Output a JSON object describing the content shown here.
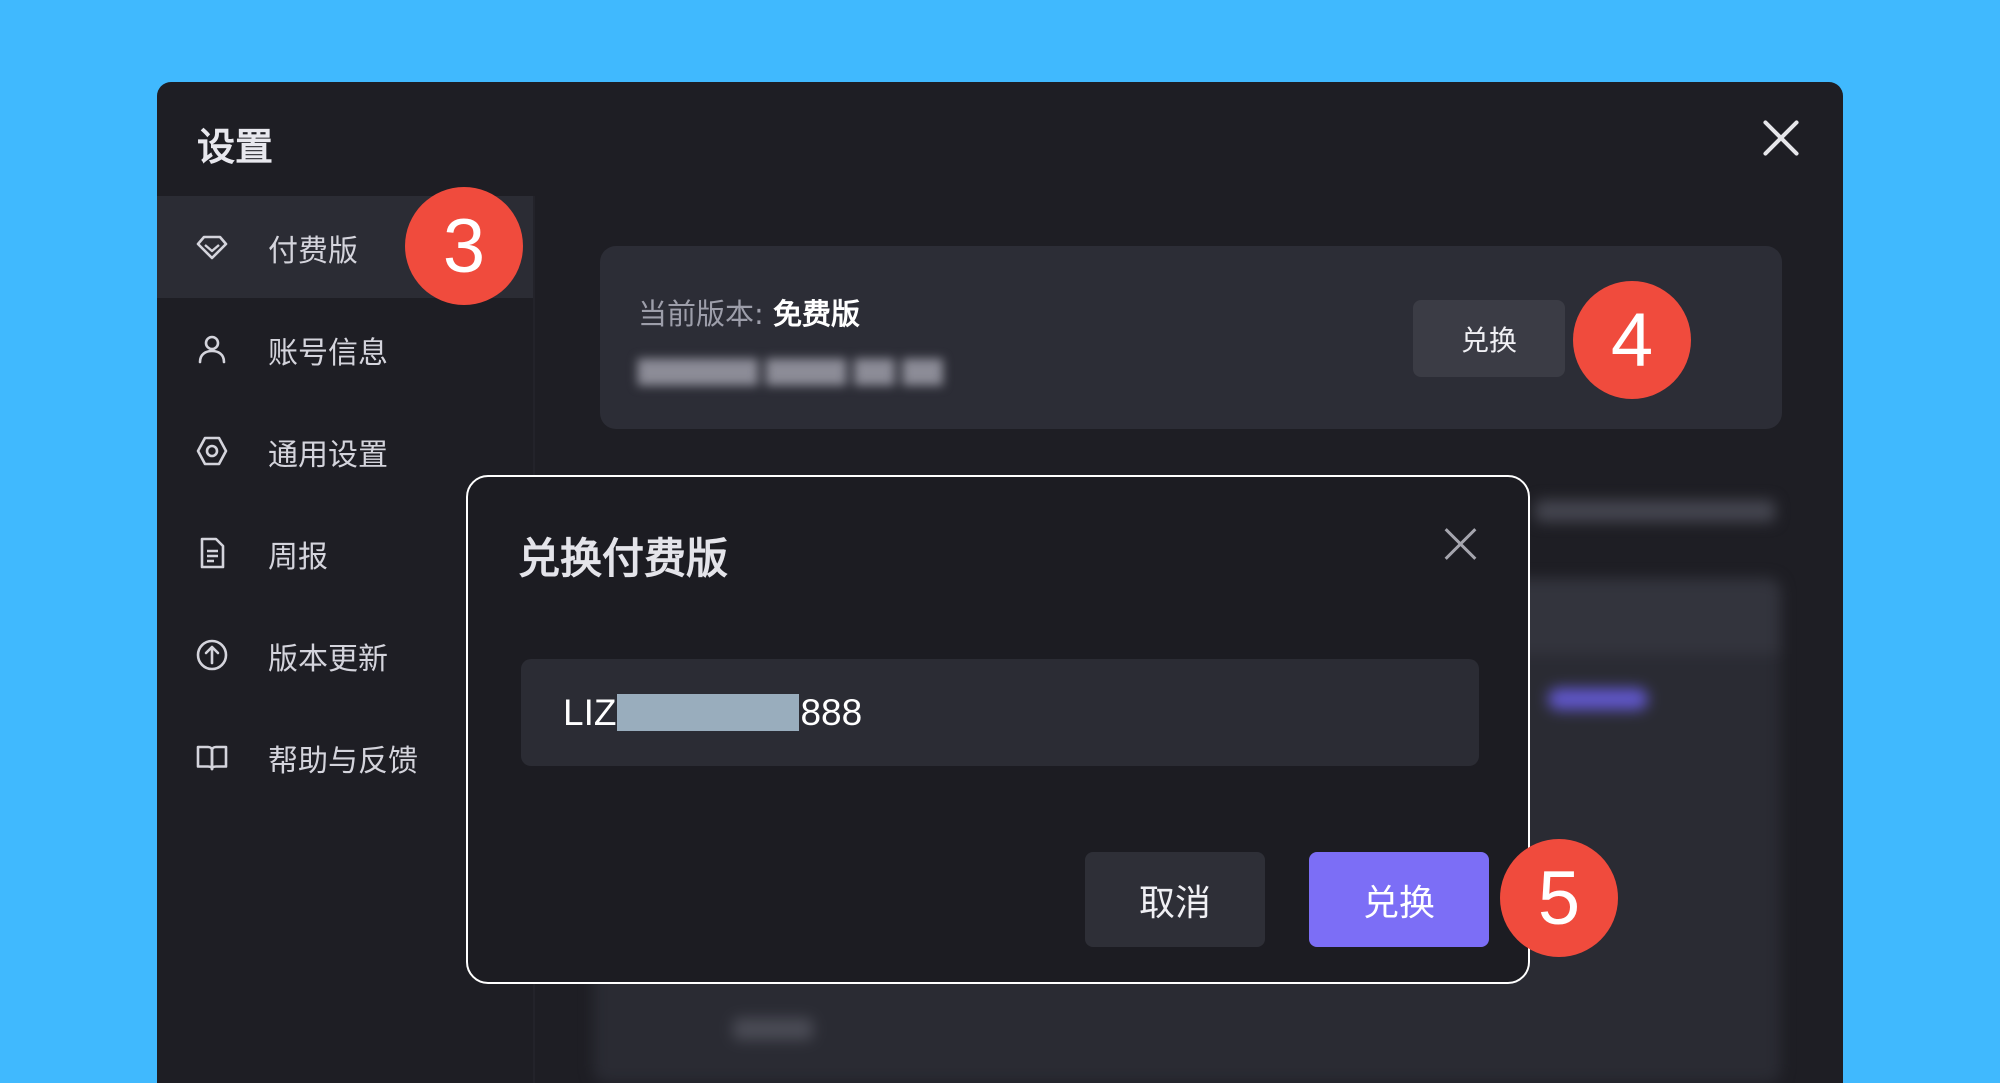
{
  "window": {
    "title": "设置"
  },
  "sidebar": {
    "items": [
      {
        "label": "付费版",
        "icon": "diamond-icon",
        "active": true
      },
      {
        "label": "账号信息",
        "icon": "user-icon"
      },
      {
        "label": "通用设置",
        "icon": "settings-icon"
      },
      {
        "label": "周报",
        "icon": "document-icon"
      },
      {
        "label": "版本更新",
        "icon": "upload-icon"
      },
      {
        "label": "帮助与反馈",
        "icon": "book-icon"
      }
    ]
  },
  "version_card": {
    "current_label": "当前版本:",
    "current_value": "免费版",
    "redeem_label": "兑换"
  },
  "dialog": {
    "title": "兑换付费版",
    "code_prefix": "LIZ",
    "code_suffix": "888",
    "cancel_label": "取消",
    "confirm_label": "兑换"
  },
  "callouts": {
    "step3": "3",
    "step4": "4",
    "step5": "5"
  },
  "colors": {
    "background": "#40b9fe",
    "window": "#1e1e24",
    "accent": "#7c6ef6",
    "badge": "#f04b3d"
  }
}
